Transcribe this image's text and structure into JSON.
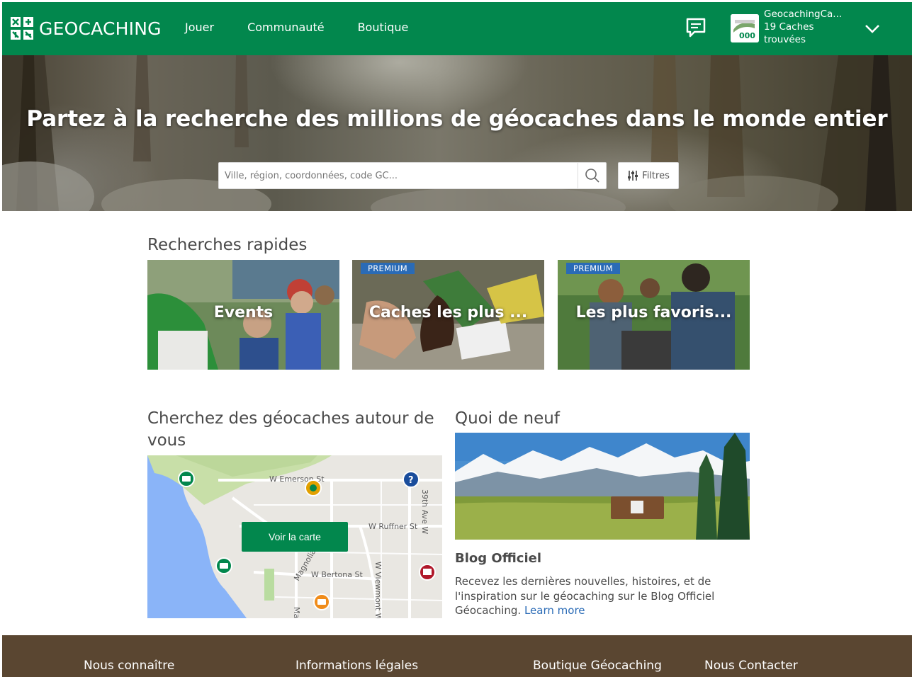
{
  "header": {
    "logo_text": "GEOCACHING",
    "nav": [
      "Jouer",
      "Communauté",
      "Boutique"
    ],
    "user_name": "GeocachingCa...",
    "user_stat": "19 Caches",
    "user_stat2": "trouvées",
    "brand_color": "#02874d"
  },
  "hero": {
    "title": "Partez à la recherche des millions de géocaches dans le monde entier",
    "search_placeholder": "Ville, région, coordonnées, code GC...",
    "filter_label": "Filtres"
  },
  "quick": {
    "title": "Recherches rapides",
    "cards": [
      {
        "label": "Events",
        "badge": ""
      },
      {
        "label": "Caches les plus ...",
        "badge": "PREMIUM"
      },
      {
        "label": "Les plus favoris...",
        "badge": "PREMIUM"
      }
    ]
  },
  "nearby": {
    "title": "Cherchez des géocaches autour de vous",
    "map_button": "Voir la carte",
    "streets": [
      "W Emerson St",
      "W Ruffner St",
      "W Bertona St",
      "39th Ave W",
      "W Viewmont Wa",
      "Magnolia Bl",
      "Ma"
    ]
  },
  "news": {
    "title": "Quoi de neuf",
    "blog_title": "Blog Officiel",
    "blog_text": "Recevez les dernières nouvelles, histoires, et de l'inspiration sur le géocaching sur le Blog Officiel Géocaching.",
    "learn_more": "Learn more"
  },
  "footer": {
    "links": [
      "Nous connaître",
      "Informations légales",
      "Boutique Géocaching",
      "Nous Contacter"
    ],
    "color": "#5a4631"
  }
}
